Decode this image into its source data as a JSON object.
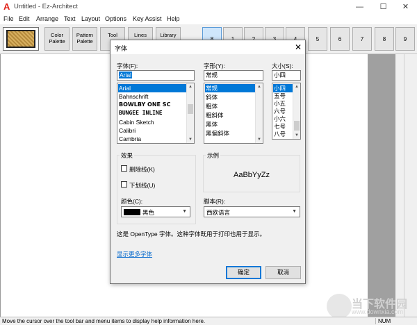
{
  "window": {
    "title": "Untitled - Ez-Architect",
    "app_icon": "A",
    "controls": {
      "minimize": "—",
      "maximize": "☐",
      "close": "✕"
    }
  },
  "menu": [
    "File",
    "Edit",
    "Arrange",
    "Text",
    "Layout",
    "Options",
    "Key Assist",
    "Help"
  ],
  "toolbar": {
    "buttons": [
      {
        "line1": "Color",
        "line2": "Palette"
      },
      {
        "line1": "Pattern",
        "line2": "Palette"
      },
      {
        "line1": "Tool",
        "line2": "Pa"
      },
      {
        "line1": "Lines",
        "line2": ""
      },
      {
        "line1": "Library",
        "line2": ""
      }
    ],
    "numbers": [
      "8",
      "1",
      "2",
      "3",
      "4",
      "5",
      "6",
      "7",
      "8",
      "9"
    ],
    "active_number_index": 0
  },
  "status": {
    "text": "Move the cursor over the tool bar and menu items to display help information here.",
    "num": "NUM"
  },
  "watermark": {
    "text": "当下软件园",
    "url": "www.downxia.com"
  },
  "font_dialog": {
    "title": "字体",
    "close": "✕",
    "font_label": "字体(F):",
    "font_value": "Arial",
    "fonts": [
      "Arial",
      "Bahnschrift",
      "BOWLBY ONE SC",
      "BUNGEE INLINE",
      "Cabin Sketch",
      "Calibri",
      "Cambria"
    ],
    "style_label": "字形(Y):",
    "style_value": "常规",
    "styles": [
      "常规",
      "斜体",
      "粗体",
      "粗斜体",
      "黑体",
      "黑偏斜体"
    ],
    "size_label": "大小(S):",
    "size_value": "小四",
    "sizes": [
      "小四",
      "五号",
      "小五",
      "六号",
      "小六",
      "七号",
      "八号"
    ],
    "effects_label": "效果",
    "strikeout": "删除线(K)",
    "underline": "下划线(U)",
    "color_label": "颜色(C):",
    "color_value": "黑色",
    "color_swatch": "#000000",
    "sample_label": "示例",
    "sample_text": "AaBbYyZz",
    "script_label": "脚本(R):",
    "script_value": "西欧语言",
    "note": "这是 OpenType 字体。这种字体既用于打印也用于显示。",
    "more_fonts": "显示更多字体",
    "ok": "确定",
    "cancel": "取消"
  }
}
